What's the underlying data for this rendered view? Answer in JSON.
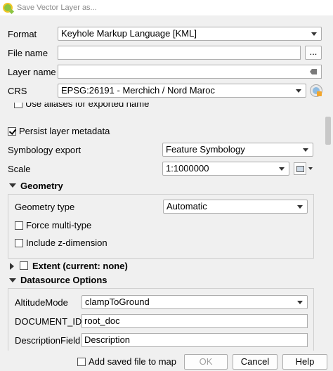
{
  "window": {
    "title": "Save Vector Layer as..."
  },
  "format": {
    "label": "Format",
    "value": "Keyhole Markup Language [KML]"
  },
  "file_name": {
    "label": "File name",
    "value": "",
    "browse_label": "..."
  },
  "layer_name": {
    "label": "Layer name",
    "value": ""
  },
  "crs": {
    "label": "CRS",
    "value": "EPSG:26191 - Merchich / Nord Maroc"
  },
  "options": {
    "use_aliases_label": "Use aliases for exported name",
    "persist_metadata_label": "Persist layer metadata",
    "symbology_export": {
      "label": "Symbology export",
      "value": "Feature Symbology"
    },
    "scale": {
      "label": "Scale",
      "value": "1:1000000"
    }
  },
  "geometry": {
    "section_label": "Geometry",
    "type": {
      "label": "Geometry type",
      "value": "Automatic"
    },
    "force_multi_label": "Force multi-type",
    "include_z_label": "Include z-dimension"
  },
  "extent": {
    "label": "Extent (current: none)"
  },
  "datasource": {
    "section_label": "Datasource Options",
    "altitude_mode": {
      "label": "AltitudeMode",
      "value": "clampToGround"
    },
    "document_id": {
      "label": "DOCUMENT_ID",
      "value": "root_doc"
    },
    "description_field": {
      "label": "DescriptionField",
      "value": "Description"
    }
  },
  "bottom": {
    "add_to_map_label": "Add saved file to map",
    "ok_label": "OK",
    "cancel_label": "Cancel",
    "help_label": "Help"
  },
  "colors": {
    "window_bg": "#f0f0f0",
    "title_text": "#8a8a8a",
    "disabled_text": "#a0a0a0"
  }
}
